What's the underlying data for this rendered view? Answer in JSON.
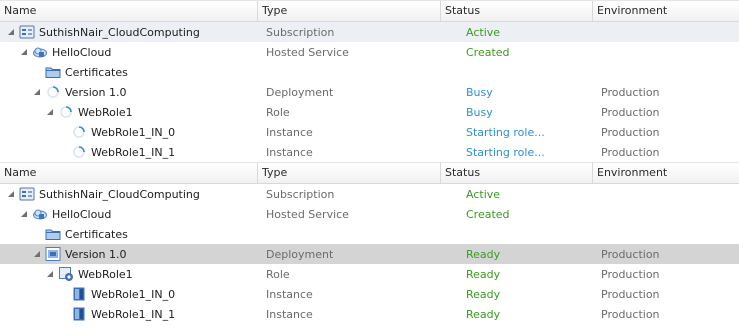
{
  "columns": {
    "name": "Name",
    "type": "Type",
    "status": "Status",
    "environment": "Environment"
  },
  "panel1": {
    "rows": [
      {
        "name": "SuthishNair_CloudComputing",
        "type": "Subscription",
        "status": "Active",
        "env": ""
      },
      {
        "name": "HelloCloud",
        "type": "Hosted Service",
        "status": "Created",
        "env": ""
      },
      {
        "name": "Certificates",
        "type": "",
        "status": "",
        "env": ""
      },
      {
        "name": "Version 1.0",
        "type": "Deployment",
        "status": "Busy",
        "env": "Production"
      },
      {
        "name": "WebRole1",
        "type": "Role",
        "status": "Busy",
        "env": "Production"
      },
      {
        "name": "WebRole1_IN_0",
        "type": "Instance",
        "status": "Starting role...",
        "env": "Production"
      },
      {
        "name": "WebRole1_IN_1",
        "type": "Instance",
        "status": "Starting role...",
        "env": "Production"
      }
    ]
  },
  "panel2": {
    "rows": [
      {
        "name": "SuthishNair_CloudComputing",
        "type": "Subscription",
        "status": "Active",
        "env": ""
      },
      {
        "name": "HelloCloud",
        "type": "Hosted Service",
        "status": "Created",
        "env": ""
      },
      {
        "name": "Certificates",
        "type": "",
        "status": "",
        "env": ""
      },
      {
        "name": "Version 1.0",
        "type": "Deployment",
        "status": "Ready",
        "env": "Production"
      },
      {
        "name": "WebRole1",
        "type": "Role",
        "status": "Ready",
        "env": "Production"
      },
      {
        "name": "WebRole1_IN_0",
        "type": "Instance",
        "status": "Ready",
        "env": "Production"
      },
      {
        "name": "WebRole1_IN_1",
        "type": "Instance",
        "status": "Ready",
        "env": "Production"
      }
    ]
  },
  "icons": {
    "subscription": "subscription-icon",
    "hosted_service": "cloud-service-icon",
    "certificates": "folder-icon",
    "busy": "spinner-icon",
    "deployment_ready": "deployment-icon",
    "role_ready": "role-icon",
    "instance_ready": "instance-icon"
  },
  "colors": {
    "status_green": "#3b9a1f",
    "status_blue": "#2f8fd6",
    "selected_row": "#d4d4d4"
  }
}
